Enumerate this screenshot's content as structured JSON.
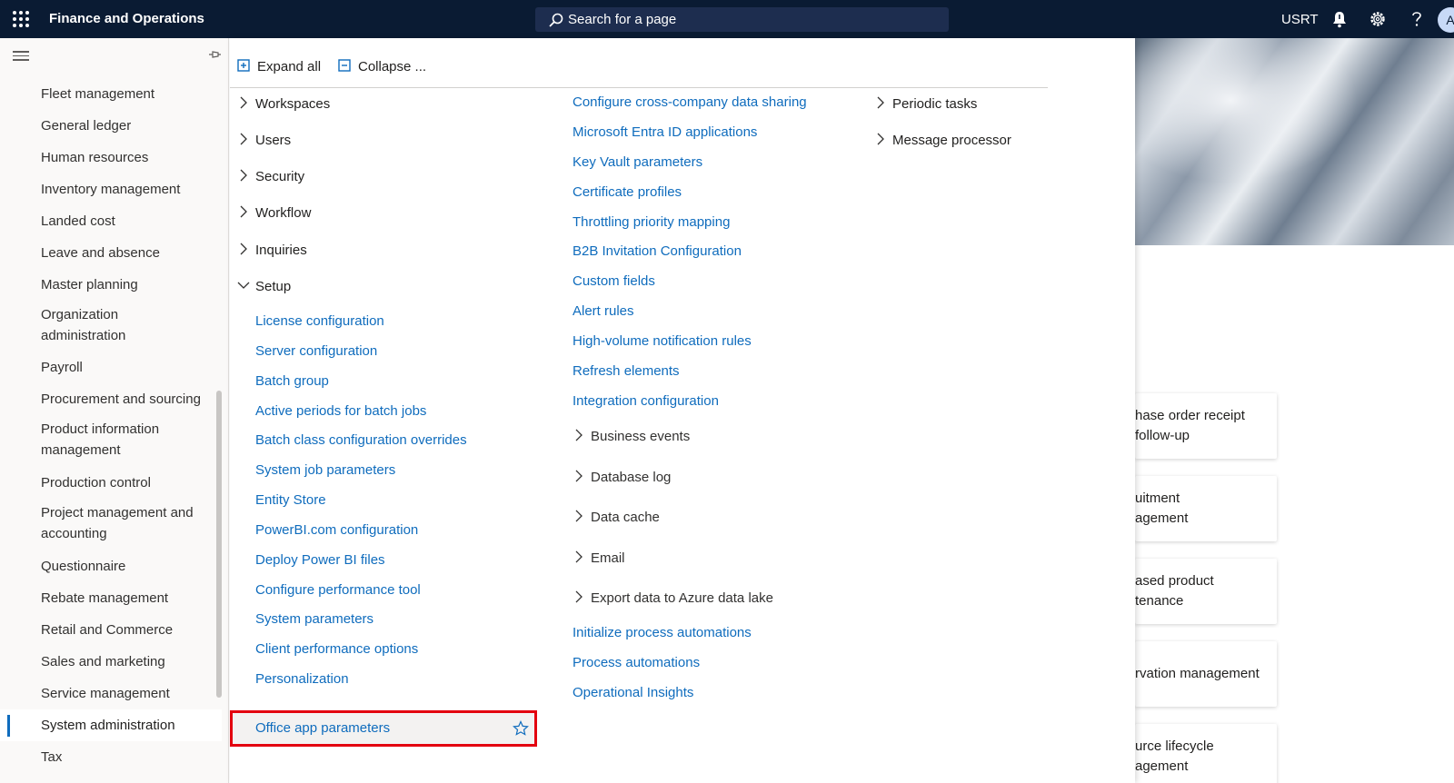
{
  "app": {
    "title": "Finance and Operations",
    "search_text": "Search for a page",
    "company": "USRT",
    "avatar": "A"
  },
  "nav": {
    "modules": [
      "Fleet management",
      "General ledger",
      "Human resources",
      "Inventory management",
      "Landed cost",
      "Leave and absence",
      "Master planning",
      "Organization administration",
      "Payroll",
      "Procurement and sourcing",
      "Product information management",
      "Production control",
      "Project management and accounting",
      "Questionnaire",
      "Rebate management",
      "Retail and Commerce",
      "Sales and marketing",
      "Service management",
      "System administration",
      "Tax"
    ],
    "selected": "System administration"
  },
  "toolbar": {
    "expand_all": "Expand all",
    "collapse": "Collapse ..."
  },
  "groups": {
    "workspaces": "Workspaces",
    "users": "Users",
    "security": "Security",
    "workflow": "Workflow",
    "inquiries": "Inquiries",
    "setup": "Setup",
    "periodic_tasks": "Periodic tasks",
    "message_processor": "Message processor"
  },
  "setup_col1": [
    "License configuration",
    "Server configuration",
    "Batch group",
    "Active periods for batch jobs",
    "Batch class configuration overrides",
    "System job parameters",
    "Entity Store",
    "PowerBI.com configuration",
    "Deploy Power BI files",
    "Configure performance tool",
    "System parameters",
    "Client performance options",
    "Personalization",
    "Office app parameters"
  ],
  "setup_col2": [
    "Configure cross-company data sharing",
    "Microsoft Entra ID applications",
    "Key Vault parameters",
    "Certificate profiles",
    "Throttling priority mapping",
    "B2B Invitation Configuration",
    "Custom fields",
    "Alert rules",
    "High-volume notification rules",
    "Refresh elements",
    "Integration configuration"
  ],
  "setup_subgroups": [
    "Business events",
    "Database log",
    "Data cache",
    "Email",
    "Export data to Azure data lake"
  ],
  "setup_col2_after": [
    "Initialize process automations",
    "Process automations",
    "Operational Insights"
  ],
  "tiles": [
    "hase order receipt\nfollow-up",
    "uitment\nagement",
    "ased product\ntenance",
    "rvation management",
    "urce lifecycle\nagement"
  ]
}
